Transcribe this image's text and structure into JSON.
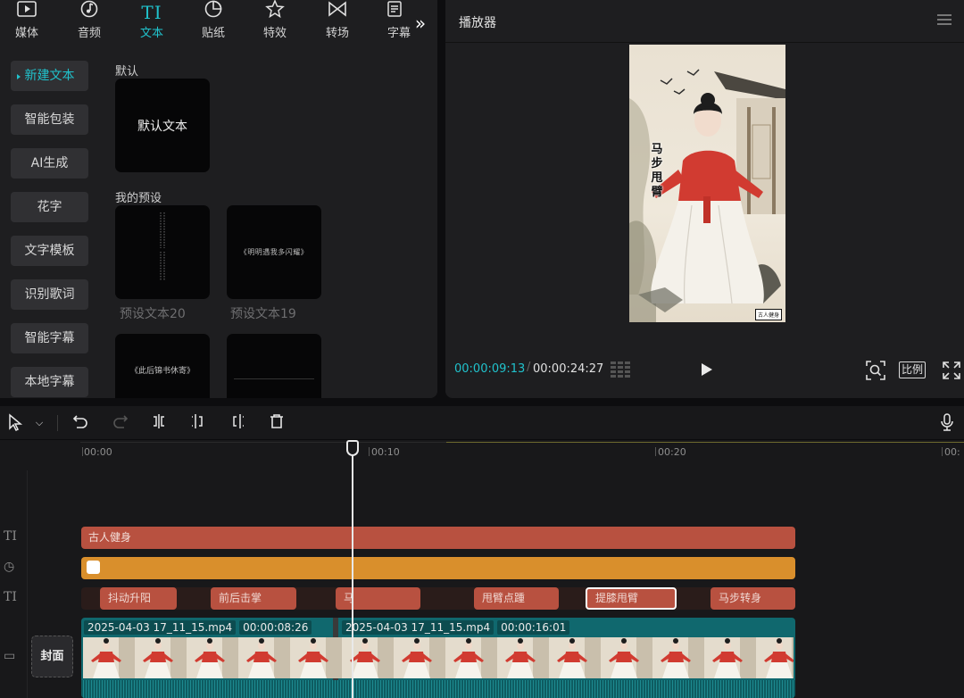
{
  "top_tabs": [
    {
      "label": "媒体",
      "icon": "media-icon"
    },
    {
      "label": "音频",
      "icon": "audio-icon"
    },
    {
      "label": "文本",
      "icon": "text-icon",
      "active": true
    },
    {
      "label": "贴纸",
      "icon": "sticker-icon"
    },
    {
      "label": "特效",
      "icon": "effects-icon"
    },
    {
      "label": "转场",
      "icon": "transition-icon"
    },
    {
      "label": "字幕",
      "icon": "subtitle-icon"
    }
  ],
  "sidebar": {
    "items": [
      {
        "label": "新建文本",
        "active": true
      },
      {
        "label": "智能包装"
      },
      {
        "label": "AI生成"
      },
      {
        "label": "花字"
      },
      {
        "label": "文字模板"
      },
      {
        "label": "识别歌词"
      },
      {
        "label": "智能字幕"
      },
      {
        "label": "本地字幕"
      }
    ]
  },
  "gallery": {
    "default_section": "默认",
    "default_card": "默认文本",
    "presets_section": "我的预设",
    "presets": [
      {
        "caption": "预设文本20",
        "preview": ""
      },
      {
        "caption": "预设文本19",
        "preview": "《明明遇我多闪耀》"
      },
      {
        "caption": "",
        "preview": "《此后锦书休寄》"
      },
      {
        "caption": "",
        "preview": ""
      }
    ]
  },
  "player": {
    "title": "播放器",
    "overlay_text": "马步甩臂",
    "watermark": "古人健身",
    "current_time": "00:00:09:13",
    "total_time": "00:00:24:27",
    "ratio_label": "比例"
  },
  "timeline": {
    "ruler": [
      "00:00",
      "00:10",
      "00:20",
      "00:"
    ],
    "track_labels": {
      "text": "TI",
      "sticker": "◷",
      "text2": "TI",
      "video": "▭"
    },
    "title_clip": "古人健身",
    "text_clips": [
      "抖动升阳",
      "前后击掌",
      "马",
      "甩臂点踵",
      "提膝甩臂",
      "马步转身"
    ],
    "video_clips": [
      {
        "name": "2025-04-03 17_11_15.mp4",
        "duration": "00:00:08:26"
      },
      {
        "name": "2025-04-03 17_11_15.mp4",
        "duration": "00:00:16:01"
      }
    ],
    "cover_label": "封面"
  },
  "colors": {
    "accent": "#20c2cc",
    "text_clip": "#b85140",
    "sticker_clip": "#d98f2c",
    "video_clip": "#10686e"
  }
}
